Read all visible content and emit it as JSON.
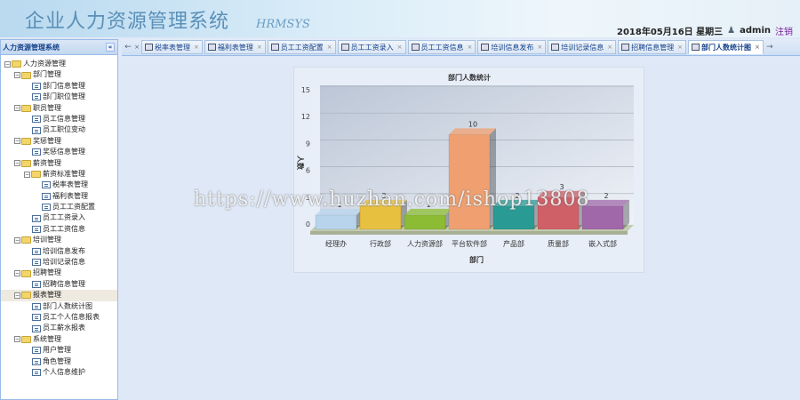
{
  "header": {
    "title": "企业人力资源管理系统",
    "subtitle": "HRMSYS",
    "date": "2018年05月16日 星期三",
    "user": "admin",
    "logout": "注销"
  },
  "sidebar": {
    "title": "人力资源管理系统",
    "collapse": "«",
    "tree": [
      {
        "label": "人力资源管理",
        "level": 0,
        "type": "folder"
      },
      {
        "label": "部门管理",
        "level": 1,
        "type": "folder"
      },
      {
        "label": "部门信息管理",
        "level": 2,
        "type": "leaf"
      },
      {
        "label": "部门职位管理",
        "level": 2,
        "type": "leaf"
      },
      {
        "label": "职员管理",
        "level": 1,
        "type": "folder"
      },
      {
        "label": "员工信息管理",
        "level": 2,
        "type": "leaf"
      },
      {
        "label": "员工职位变动",
        "level": 2,
        "type": "leaf"
      },
      {
        "label": "奖惩管理",
        "level": 1,
        "type": "folder"
      },
      {
        "label": "奖惩信息管理",
        "level": 2,
        "type": "leaf"
      },
      {
        "label": "薪资管理",
        "level": 1,
        "type": "folder"
      },
      {
        "label": "薪资标准管理",
        "level": 2,
        "type": "folder"
      },
      {
        "label": "税率表管理",
        "level": 3,
        "type": "leaf"
      },
      {
        "label": "福利表管理",
        "level": 3,
        "type": "leaf"
      },
      {
        "label": "员工工资配置",
        "level": 3,
        "type": "leaf"
      },
      {
        "label": "员工工资录入",
        "level": 2,
        "type": "leaf"
      },
      {
        "label": "员工工资信息",
        "level": 2,
        "type": "leaf"
      },
      {
        "label": "培训管理",
        "level": 1,
        "type": "folder"
      },
      {
        "label": "培训信息发布",
        "level": 2,
        "type": "leaf"
      },
      {
        "label": "培训记录信息",
        "level": 2,
        "type": "leaf"
      },
      {
        "label": "招聘管理",
        "level": 1,
        "type": "folder"
      },
      {
        "label": "招聘信息管理",
        "level": 2,
        "type": "leaf"
      },
      {
        "label": "报表管理",
        "level": 1,
        "type": "folder",
        "selected": true
      },
      {
        "label": "部门人数统计图",
        "level": 2,
        "type": "leaf"
      },
      {
        "label": "员工个人信息报表",
        "level": 2,
        "type": "leaf"
      },
      {
        "label": "员工薪水报表",
        "level": 2,
        "type": "leaf"
      },
      {
        "label": "系统管理",
        "level": 1,
        "type": "folder"
      },
      {
        "label": "用户管理",
        "level": 2,
        "type": "leaf"
      },
      {
        "label": "角色管理",
        "level": 2,
        "type": "leaf"
      },
      {
        "label": "个人信息维护",
        "level": 2,
        "type": "leaf"
      }
    ]
  },
  "tabs": [
    {
      "label": "税率表管理"
    },
    {
      "label": "福利表管理"
    },
    {
      "label": "员工工资配置"
    },
    {
      "label": "员工工资录入"
    },
    {
      "label": "员工工资信息"
    },
    {
      "label": "培训信息发布"
    },
    {
      "label": "培训记录信息"
    },
    {
      "label": "招聘信息管理"
    },
    {
      "label": "部门人数统计图",
      "active": true
    }
  ],
  "tab_close": "×",
  "watermark": "https://www.huzhan.com/ishop13808",
  "chart_data": {
    "type": "bar",
    "title": "部门人数统计",
    "xlabel": "部门",
    "ylabel": "人数",
    "categories": [
      "经理办",
      "行政部",
      "人力资源部",
      "平台软件部",
      "产品部",
      "质量部",
      "嵌入式部"
    ],
    "values": [
      1,
      2,
      1,
      10,
      2,
      3,
      2
    ],
    "colors": [
      "#b8d4ec",
      "#e8c040",
      "#8cbc34",
      "#f0a070",
      "#2a9a94",
      "#d06068",
      "#a068a8"
    ],
    "ylim": [
      0,
      15
    ],
    "yticks": [
      0,
      3,
      6,
      9,
      12,
      15
    ],
    "grid": true
  }
}
